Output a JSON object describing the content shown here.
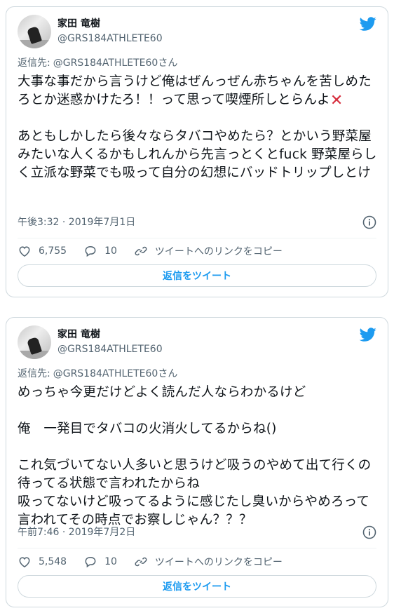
{
  "tweets": [
    {
      "author": {
        "name": "家田 竜樹",
        "handle": "@GRS184ATHLETE60"
      },
      "reply_to": {
        "label": "返信先:",
        "handle": "@GRS184ATHLETE60さん"
      },
      "text_before_icon": "大事な事だから言うけど俺はぜんっぜん赤ちゃんを苦しめたろとか迷惑かけたろ！！って思って喫煙所しとらんよ",
      "inline_icon": "cross-mark-icon",
      "text_after_icon": "\n\nあともしかしたら後々ならタバコやめたら？とかいう野菜屋みたいな人くるかもしれんから先言っとくとfuck 野菜屋らしく立派な野菜でも吸って自分の幻想にバッドトリップしとけ",
      "timestamp": "午後3:32 · 2019年7月1日",
      "likes": "6,755",
      "replies": "10",
      "copy_link_label": "ツイートへのリンクをコピー",
      "reply_button_label": "返信をツイート"
    },
    {
      "author": {
        "name": "家田 竜樹",
        "handle": "@GRS184ATHLETE60"
      },
      "reply_to": {
        "label": "返信先:",
        "handle": "@GRS184ATHLETE60さん"
      },
      "text_before_icon": "めっちゃ今更だけどよく読んだ人ならわかるけど\n\n俺　一発目でタバコの火消火してるからね()\n\nこれ気づいてない人多いと思うけど吸うのやめて出て行くの待ってる状態で言われたからね\n吸ってないけど吸ってるように感じたし臭いからやめろって言われてその時点でお察しじゃん？？？",
      "inline_icon": "",
      "text_after_icon": "",
      "timestamp": "午前7:46 · 2019年7月2日",
      "likes": "5,548",
      "replies": "10",
      "copy_link_label": "ツイートへのリンクをコピー",
      "reply_button_label": "返信をツイート"
    }
  ],
  "colors": {
    "accent": "#1d9bf0",
    "muted": "#536471",
    "border": "#cfd9de",
    "cross": "#d62b3b"
  },
  "icons": {
    "brand": "twitter-bird-icon",
    "like": "heart-icon",
    "reply": "speech-bubble-icon",
    "link": "link-icon",
    "info": "info-icon"
  }
}
